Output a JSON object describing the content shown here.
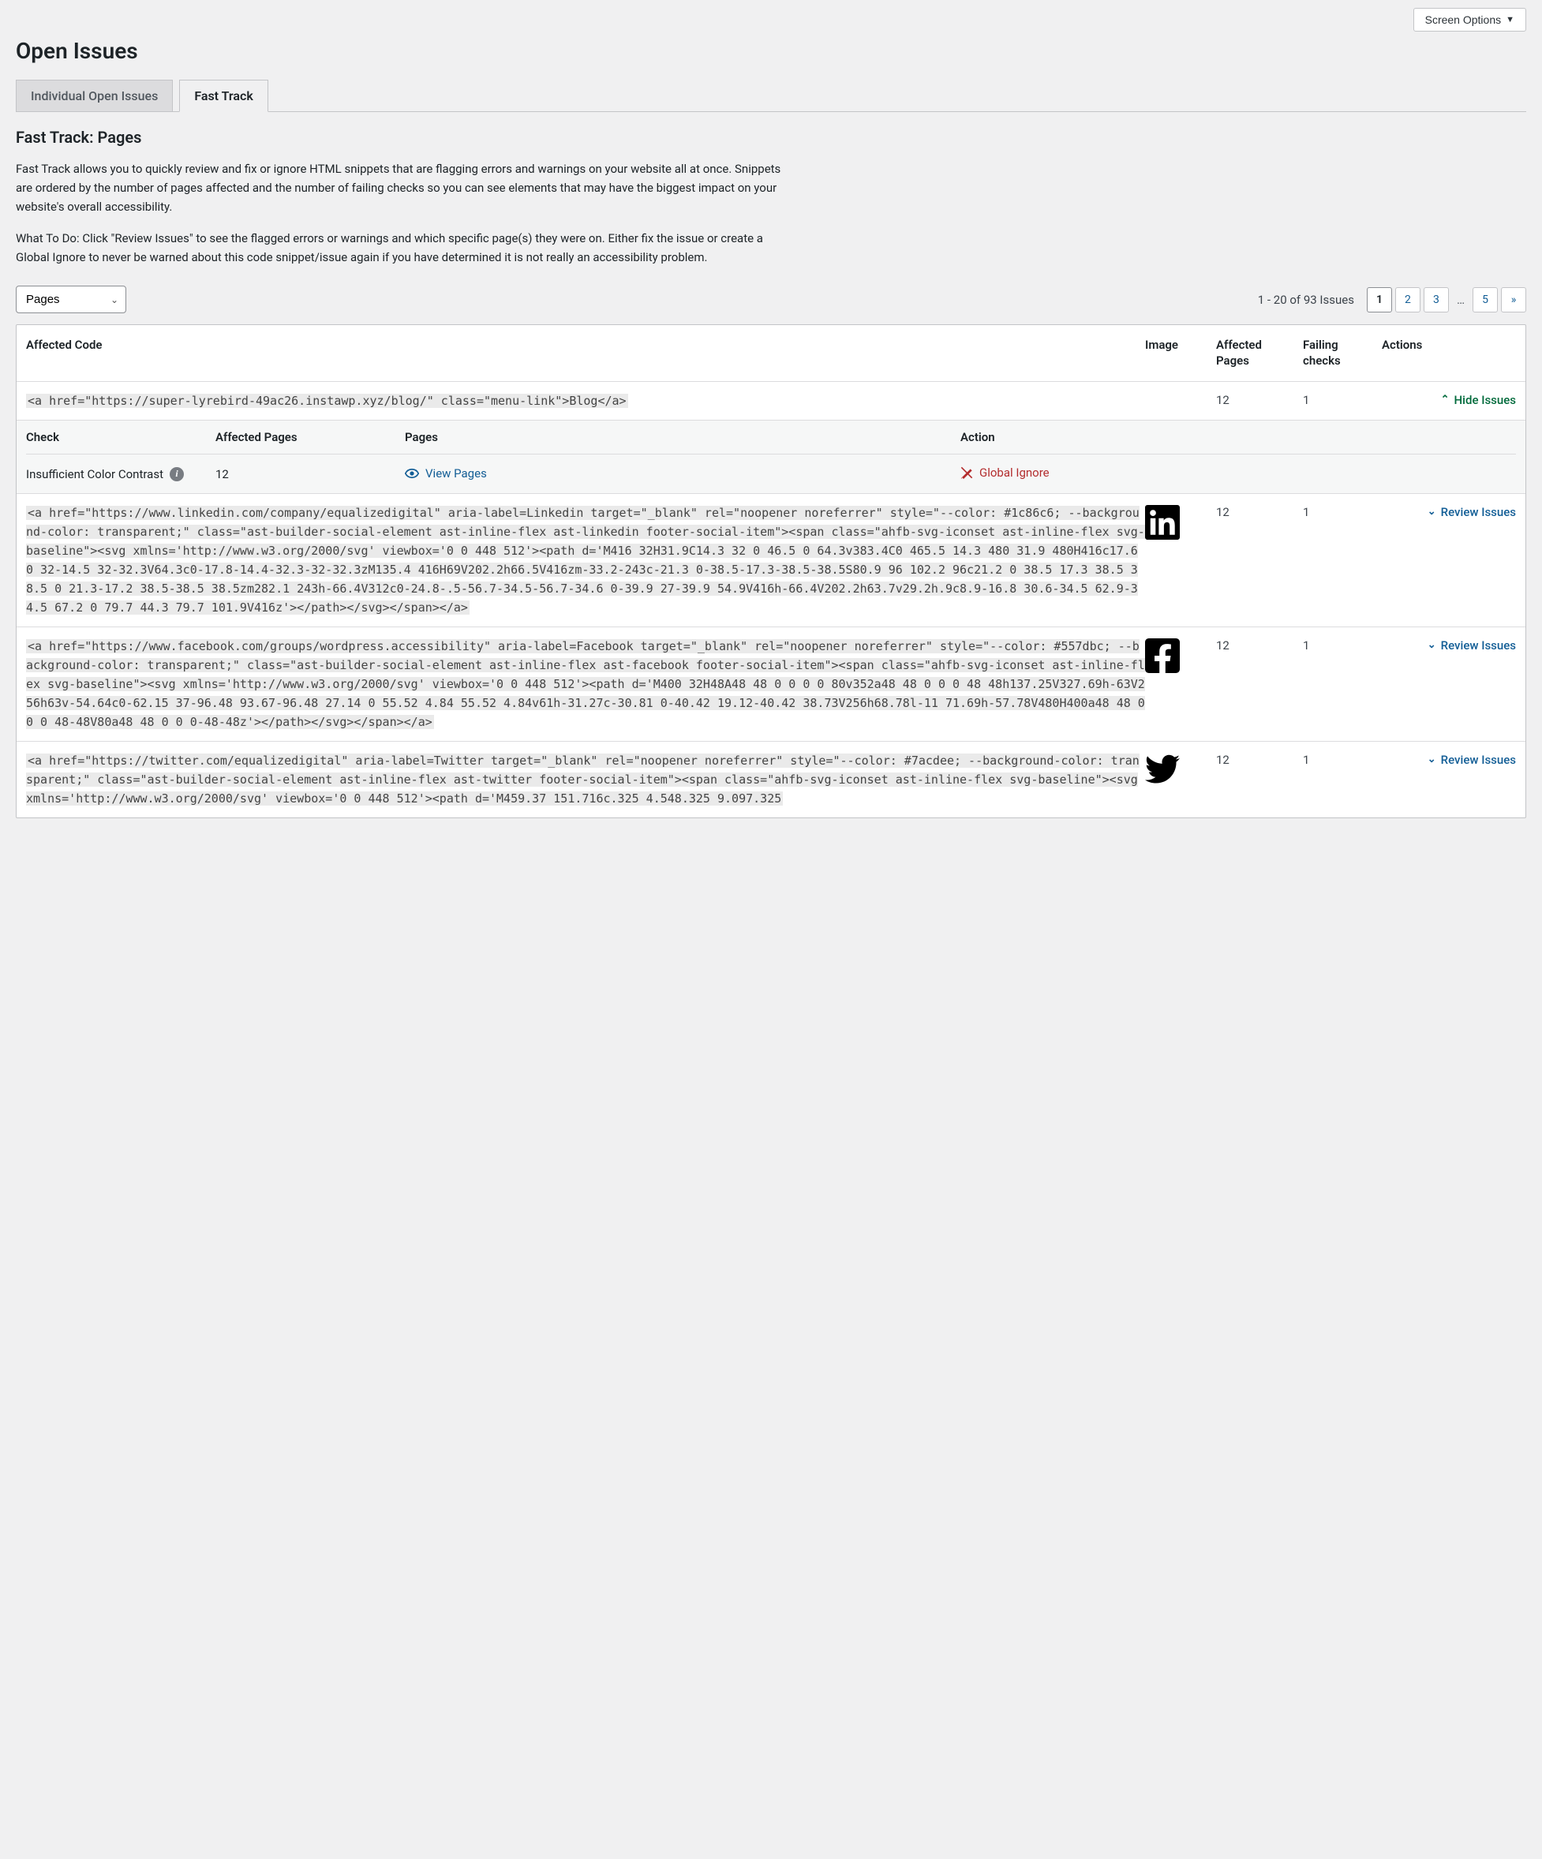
{
  "screen_options_label": "Screen Options",
  "page_title": "Open Issues",
  "tabs": [
    {
      "label": "Individual Open Issues",
      "active": false
    },
    {
      "label": "Fast Track",
      "active": true
    }
  ],
  "section_title": "Fast Track: Pages",
  "desc1": "Fast Track allows you to quickly review and fix or ignore HTML snippets that are flagging errors and warnings on your website all at once. Snippets are ordered by the number of pages affected and the number of failing checks so you can see elements that may have the biggest impact on your website's overall accessibility.",
  "desc2": "What To Do: Click \"Review Issues\" to see the flagged errors or warnings and which specific page(s) they were on. Either fix the issue or create a Global Ignore to never be warned about this code snippet/issue again if you have determined it is not really an accessibility problem.",
  "filter_select_value": "Pages",
  "counter_text": "1 - 20 of 93 Issues",
  "pagination": {
    "current": "1",
    "pages": [
      "2",
      "3"
    ],
    "ellipsis": "…",
    "last": "5",
    "next": "»"
  },
  "columns": {
    "code": "Affected Code",
    "image": "Image",
    "pages": "Affected Pages",
    "checks": "Failing checks",
    "actions": "Actions"
  },
  "hide_label": "Hide Issues",
  "review_label": "Review Issues",
  "rows": [
    {
      "code": "<a href=\"https://super-lyrebird-49ac26.instawp.xyz/blog/\" class=\"menu-link\">Blog</a>",
      "pages": "12",
      "checks": "1",
      "expanded": true
    },
    {
      "code": "<a href=\"https://www.linkedin.com/company/equalizedigital\" aria-label=Linkedin target=\"_blank\" rel=\"noopener noreferrer\" style=\"--color: #1c86c6; --background-color: transparent;\" class=\"ast-builder-social-element ast-inline-flex ast-linkedin footer-social-item\"><span class=\"ahfb-svg-iconset ast-inline-flex svg-baseline\"><svg xmlns='http://www.w3.org/2000/svg' viewbox='0 0 448 512'><path d='M416 32H31.9C14.3 32 0 46.5 0 64.3v383.4C0 465.5 14.3 480 31.9 480H416c17.6 0 32-14.5 32-32.3V64.3c0-17.8-14.4-32.3-32-32.3zM135.4 416H69V202.2h66.5V416zm-33.2-243c-21.3 0-38.5-17.3-38.5-38.5S80.9 96 102.2 96c21.2 0 38.5 17.3 38.5 38.5 0 21.3-17.2 38.5-38.5 38.5zm282.1 243h-66.4V312c0-24.8-.5-56.7-34.5-56.7-34.6 0-39.9 27-39.9 54.9V416h-66.4V202.2h63.7v29.2h.9c8.9-16.8 30.6-34.5 62.9-34.5 67.2 0 79.7 44.3 79.7 101.9V416z'></path></svg></span></a>",
      "image": "linkedin",
      "pages": "12",
      "checks": "1"
    },
    {
      "code": "<a href=\"https://www.facebook.com/groups/wordpress.accessibility\" aria-label=Facebook target=\"_blank\" rel=\"noopener noreferrer\" style=\"--color: #557dbc; --background-color: transparent;\" class=\"ast-builder-social-element ast-inline-flex ast-facebook footer-social-item\"><span class=\"ahfb-svg-iconset ast-inline-flex svg-baseline\"><svg xmlns='http://www.w3.org/2000/svg' viewbox='0 0 448 512'><path d='M400 32H48A48 48 0 0 0 0 80v352a48 48 0 0 0 48 48h137.25V327.69h-63V256h63v-54.64c0-62.15 37-96.48 93.67-96.48 27.14 0 55.52 4.84 55.52 4.84v61h-31.27c-30.81 0-40.42 19.12-40.42 38.73V256h68.78l-11 71.69h-57.78V480H400a48 48 0 0 0 48-48V80a48 48 0 0 0-48-48z'></path></svg></span></a>",
      "image": "facebook",
      "pages": "12",
      "checks": "1"
    },
    {
      "code": "<a href=\"https://twitter.com/equalizedigital\" aria-label=Twitter target=\"_blank\" rel=\"noopener noreferrer\" style=\"--color: #7acdee; --background-color: transparent;\" class=\"ast-builder-social-element ast-inline-flex ast-twitter footer-social-item\"><span class=\"ahfb-svg-iconset ast-inline-flex svg-baseline\"><svg xmlns='http://www.w3.org/2000/svg' viewbox='0 0 448 512'><path d='M459.37 151.716c.325 4.548.325 9.097.325",
      "image": "twitter",
      "pages": "12",
      "checks": "1"
    }
  ],
  "sub_columns": {
    "check": "Check",
    "affected": "Affected Pages",
    "pages": "Pages",
    "action": "Action"
  },
  "sub_row": {
    "check": "Insufficient Color Contrast",
    "affected": "12",
    "view_label": "View Pages",
    "ignore_label": "Global Ignore"
  }
}
